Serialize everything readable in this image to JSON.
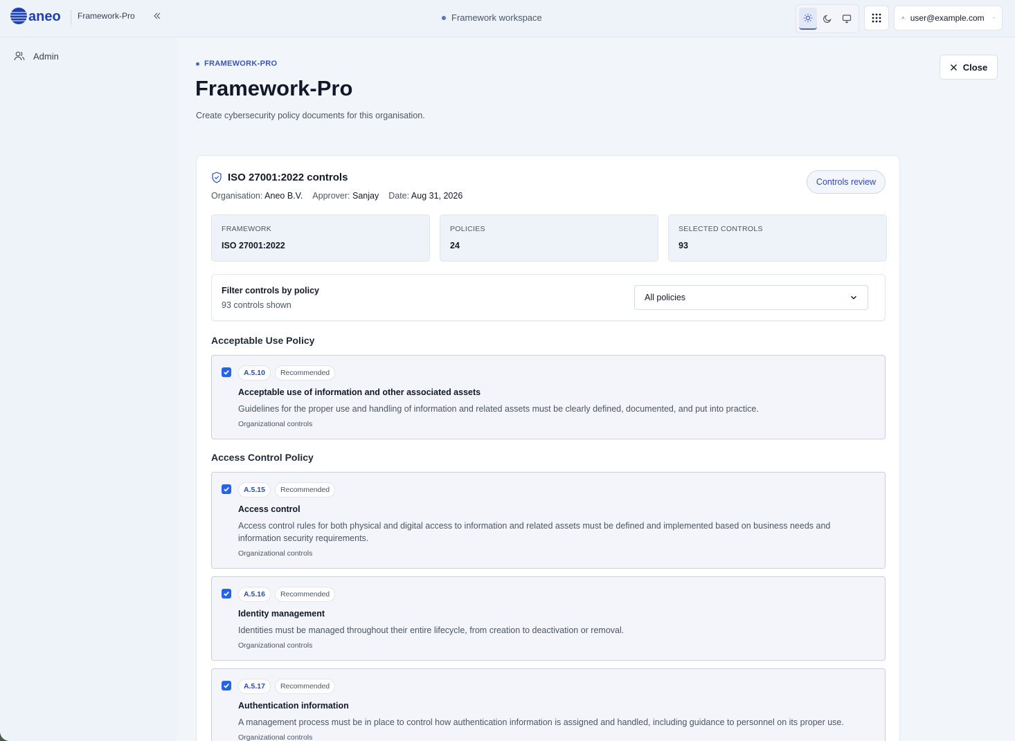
{
  "topbar": {
    "app_name": "Framework-Pro",
    "workspace": "Framework workspace",
    "user_email": "user@example.com"
  },
  "sidebar": {
    "items": [
      {
        "label": "Admin",
        "icon": "user-icon"
      }
    ]
  },
  "page": {
    "breadcrumb": "FRAMEWORK-PRO",
    "title": "Framework-Pro",
    "subtitle": "Create cybersecurity policy documents for this organisation.",
    "close_label": "Close"
  },
  "card": {
    "title": "ISO 27001:2022 controls",
    "meta": {
      "organisation_label": "Organisation:",
      "organisation": "Aneo B.V.",
      "approver_label": "Approver:",
      "approver": "Sanjay",
      "date_label": "Date:",
      "date": "Aug 31, 2026"
    },
    "review_label": "Controls review",
    "stats": [
      {
        "label": "FRAMEWORK",
        "value": "ISO 27001:2022"
      },
      {
        "label": "POLICIES",
        "value": "24"
      },
      {
        "label": "SELECTED CONTROLS",
        "value": "93"
      }
    ],
    "filter": {
      "title": "Filter controls by policy",
      "count": "93 controls shown",
      "selected": "All policies"
    }
  },
  "sections": [
    {
      "title": "Acceptable Use Policy",
      "controls": [
        {
          "id": "A.5.10",
          "badge": "Recommended",
          "checked": true,
          "title": "Acceptable use of information and other associated assets",
          "description": "Guidelines for the proper use and handling of information and related assets must be clearly defined, documented, and put into practice.",
          "category": "Organizational controls"
        }
      ]
    },
    {
      "title": "Access Control Policy",
      "controls": [
        {
          "id": "A.5.15",
          "badge": "Recommended",
          "checked": true,
          "title": "Access control",
          "description": "Access control rules for both physical and digital access to information and related assets must be defined and implemented based on business needs and information security requirements.",
          "category": "Organizational controls"
        },
        {
          "id": "A.5.16",
          "badge": "Recommended",
          "checked": true,
          "title": "Identity management",
          "description": "Identities must be managed throughout their entire lifecycle, from creation to deactivation or removal.",
          "category": "Organizational controls"
        },
        {
          "id": "A.5.17",
          "badge": "Recommended",
          "checked": true,
          "title": "Authentication information",
          "description": "A management process must be in place to control how authentication information is assigned and handled, including guidance to personnel on its proper use.",
          "category": "Organizational controls"
        }
      ]
    }
  ],
  "colors": {
    "accent": "#2563eb",
    "brand": "#1e40af"
  }
}
